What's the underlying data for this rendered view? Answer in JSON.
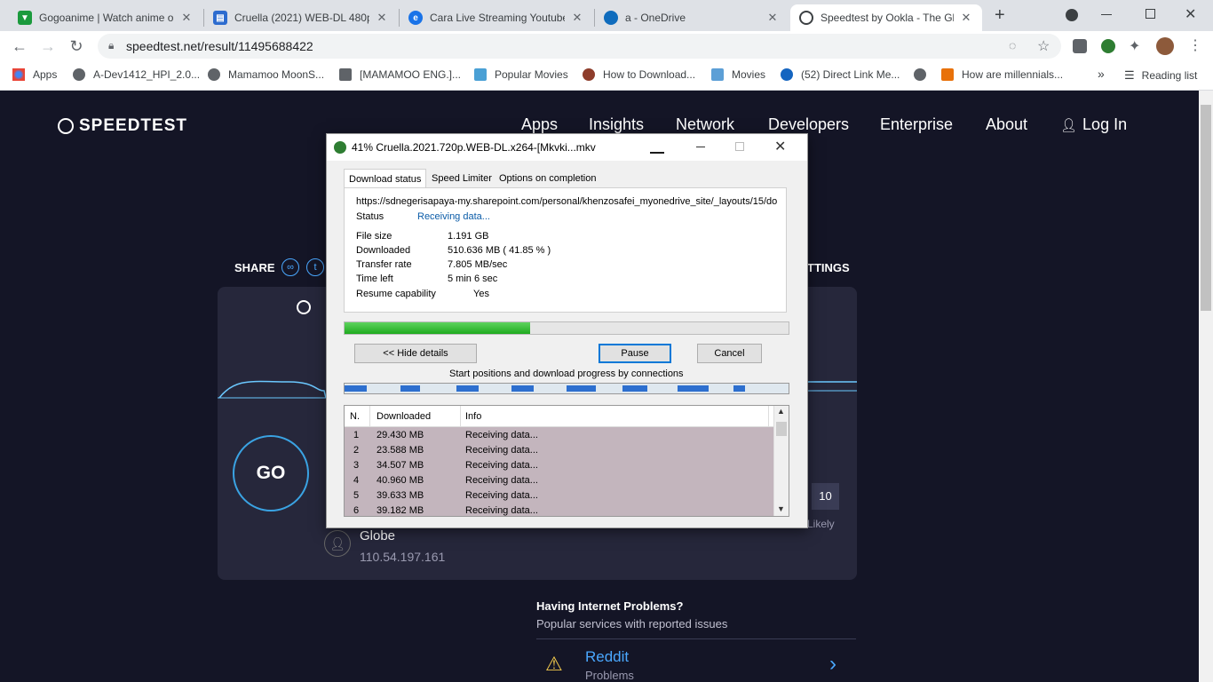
{
  "browser": {
    "tabs": [
      {
        "title": "Gogoanime | Watch anime o",
        "color": "#1b9a3d"
      },
      {
        "title": "Cruella (2021) WEB-DL 480p",
        "color": "#2d6ccf"
      },
      {
        "title": "Cara Live Streaming Youtube",
        "color": "#1a73e8"
      },
      {
        "title": "a - OneDrive",
        "color": "#0f6cbd"
      },
      {
        "title": "Speedtest by Ookla - The Glo",
        "color": "#ffffff"
      }
    ],
    "url": "speedtest.net/result/11495688422",
    "bookmarks": [
      {
        "label": "Apps",
        "color": "#4285f4"
      },
      {
        "label": "A-Dev1412_HPI_2.0...",
        "color": "#5f6368"
      },
      {
        "label": "Mamamoo MoonS...",
        "color": "#5f6368"
      },
      {
        "label": "[MAMAMOO ENG.]...",
        "color": "#5f6368"
      },
      {
        "label": "Popular Movies",
        "color": "#4aa0d5"
      },
      {
        "label": "How to Download...",
        "color": "#8e3d2b"
      },
      {
        "label": "Movies",
        "color": "#5c9fd6"
      },
      {
        "label": "(52) Direct Link Me...",
        "color": "#1565c0"
      },
      {
        "label": "How are millennials...",
        "color": "#e8710a"
      }
    ],
    "more": "»",
    "reading_list": "Reading list"
  },
  "speedtest": {
    "logo": "SPEEDTEST",
    "nav": [
      "Apps",
      "Insights",
      "Network",
      "Developers",
      "Enterprise",
      "About"
    ],
    "login": "Log In",
    "share": "SHARE",
    "settings": "TTINGS",
    "go": "GO",
    "isp_name": "Globe",
    "ip": "110.54.197.161",
    "score": "10",
    "likely": "Likely",
    "problems_title": "Having Internet Problems?",
    "problems_sub": "Popular services with reported issues",
    "service_name": "Reddit",
    "service_status": "Problems"
  },
  "dialog": {
    "title": "41% Cruella.2021.720p.WEB-DL.x264-[Mkvki...mkv",
    "tabs": [
      "Download status",
      "Speed Limiter",
      "Options on completion"
    ],
    "url": "https://sdnegerisapaya-my.sharepoint.com/personal/khenzosafei_myonedrive_site/_layouts/15/do",
    "status_label": "Status",
    "status_value": "Receiving data...",
    "fields": [
      {
        "label": "File size",
        "value": "1.191  GB"
      },
      {
        "label": "Downloaded",
        "value": "510.636  MB  ( 41.85 % )"
      },
      {
        "label": "Transfer rate",
        "value": "7.805  MB/sec"
      },
      {
        "label": "Time left",
        "value": "5 min 6 sec"
      },
      {
        "label": "Resume capability",
        "value": "Yes"
      }
    ],
    "progress": 0.4185,
    "hide_details": "<< Hide details",
    "pause": "Pause",
    "cancel": "Cancel",
    "connections_label": "Start positions and download progress by connections",
    "table_headers": [
      "N.",
      "Downloaded",
      "Info"
    ],
    "rows": [
      {
        "n": "1",
        "downloaded": "29.430  MB",
        "info": "Receiving data..."
      },
      {
        "n": "2",
        "downloaded": "23.588  MB",
        "info": "Receiving data..."
      },
      {
        "n": "3",
        "downloaded": "34.507  MB",
        "info": "Receiving data..."
      },
      {
        "n": "4",
        "downloaded": "40.960  MB",
        "info": "Receiving data..."
      },
      {
        "n": "5",
        "downloaded": "39.633  MB",
        "info": "Receiving data..."
      },
      {
        "n": "6",
        "downloaded": "39.182  MB",
        "info": "Receiving data..."
      }
    ]
  }
}
